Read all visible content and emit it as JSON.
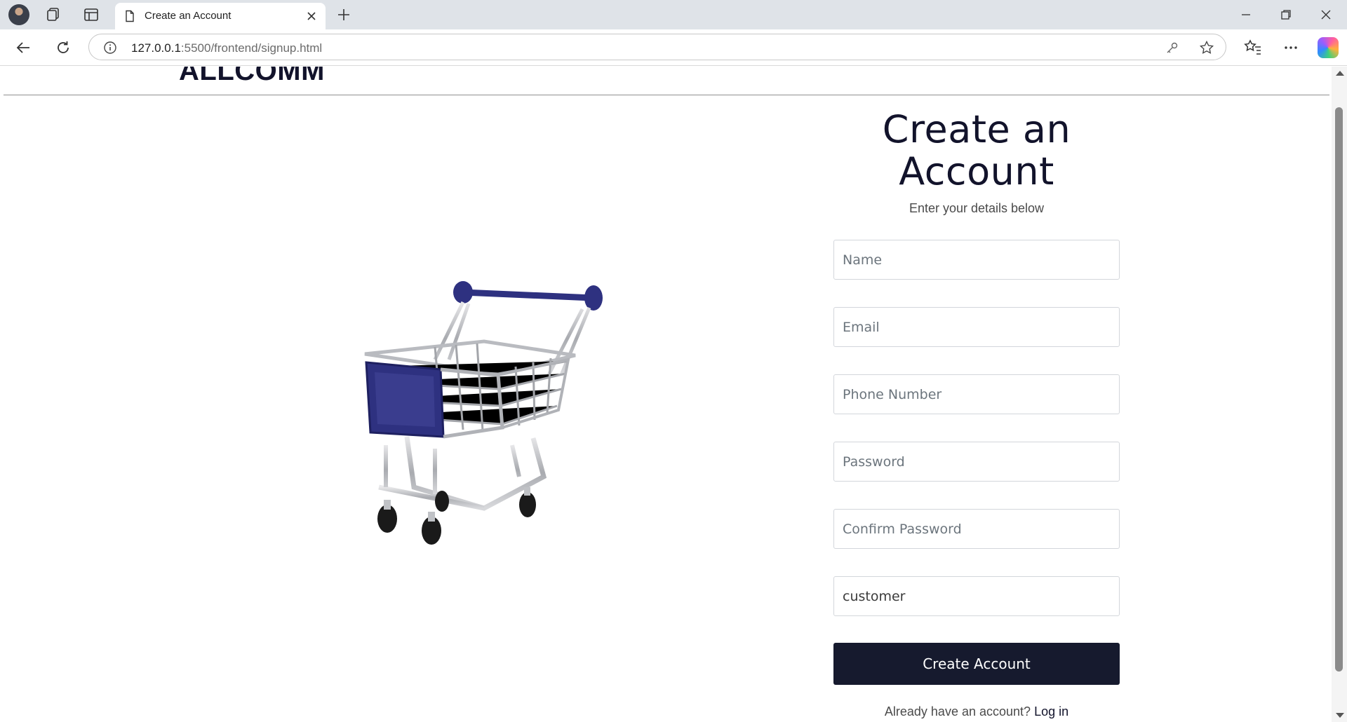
{
  "browser": {
    "tab_title": "Create an Account",
    "url_host": "127.0.0.1",
    "url_rest": ":5500/frontend/signup.html"
  },
  "page": {
    "logo": "ALLCOMM",
    "title": "Create an Account",
    "subtitle": "Enter your details below",
    "fields": {
      "name_placeholder": "Name",
      "email_placeholder": "Email",
      "phone_placeholder": "Phone Number",
      "password_placeholder": "Password",
      "confirm_placeholder": "Confirm Password"
    },
    "role_value": "customer",
    "submit_label": "Create Account",
    "login_prompt": "Already have an account?",
    "login_link": "Log in"
  },
  "colors": {
    "primary": "#161a2e",
    "tab_strip": "#dfe3e8",
    "cart_accent": "#2e3180"
  },
  "icons": [
    "profile-avatar-icon",
    "workspaces-icon",
    "vertical-tabs-icon",
    "document-icon",
    "close-icon",
    "plus-icon",
    "minimize-icon",
    "restore-icon",
    "back-arrow-icon",
    "refresh-icon",
    "info-icon",
    "key-icon",
    "star-icon",
    "favorites-icon",
    "more-icon",
    "copilot-icon",
    "shopping-cart-image"
  ]
}
